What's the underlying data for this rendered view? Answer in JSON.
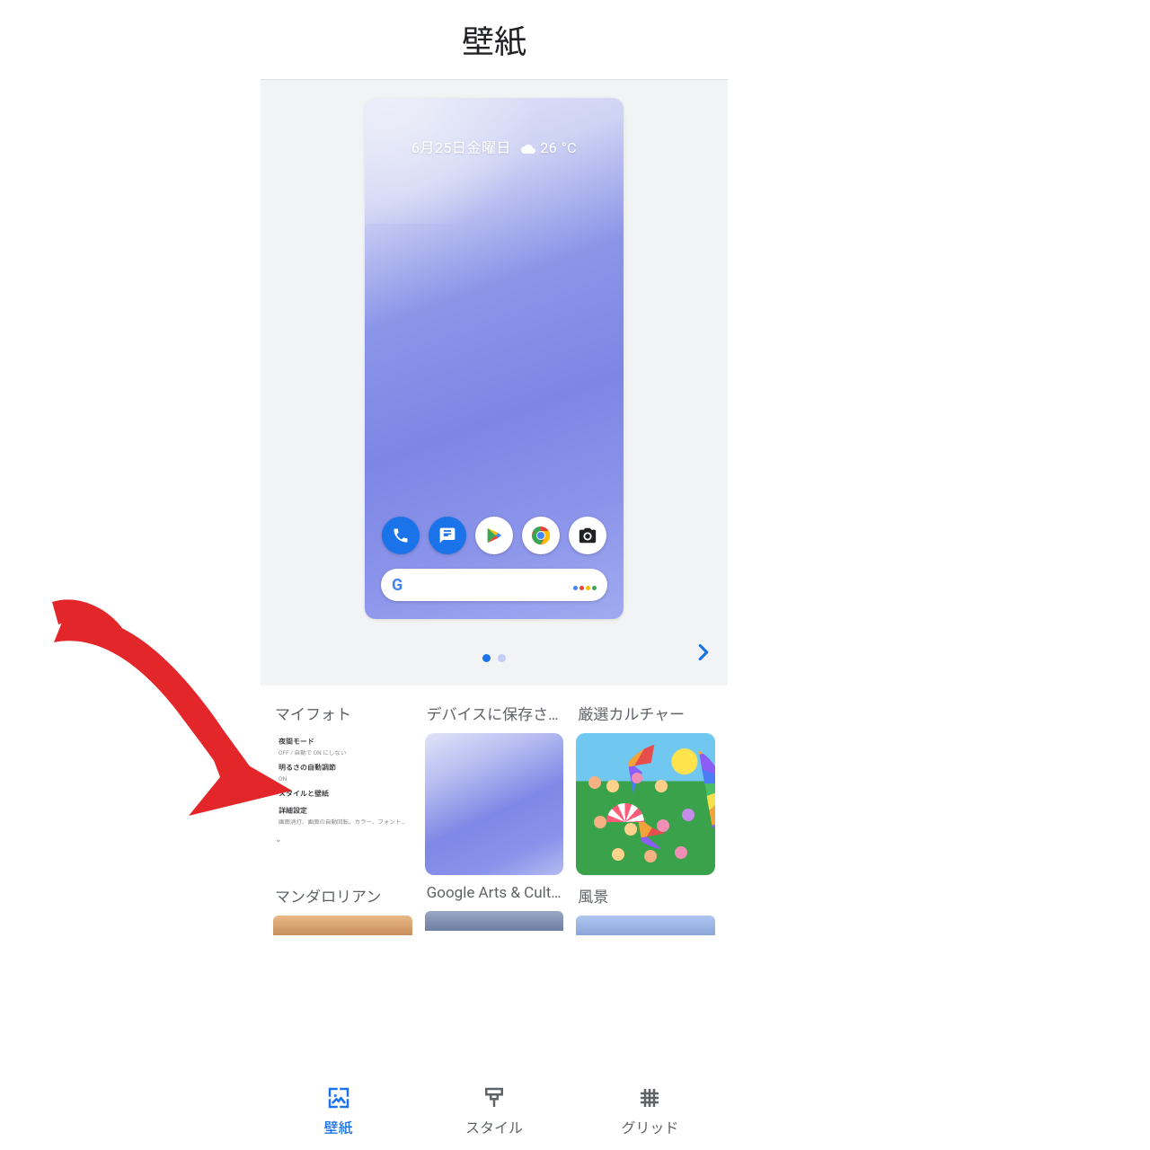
{
  "header": {
    "title": "壁紙"
  },
  "preview": {
    "weather_text": "6月25日金曜日",
    "weather_temp": "26 °C",
    "pager": {
      "active_index": 0,
      "count": 2
    }
  },
  "categories_row1": [
    {
      "title": "マイフォト",
      "settings": [
        {
          "title": "夜間モード",
          "sub": "OFF / 自動で ON にしない"
        },
        {
          "title": "明るさの自動調節",
          "sub": "ON"
        },
        {
          "title": "スタイルと壁紙",
          "sub": ""
        },
        {
          "title": "詳細設定",
          "sub": "画面消灯、画面の自動回転、カラー、フォント…"
        }
      ]
    },
    {
      "title": "デバイスに保存され..."
    },
    {
      "title": "厳選カルチャー"
    }
  ],
  "categories_row2": [
    {
      "title": "マンダロリアン"
    },
    {
      "title": "Google Arts & Cult..."
    },
    {
      "title": "風景"
    }
  ],
  "bottom_nav": [
    {
      "label": "壁紙",
      "active": true
    },
    {
      "label": "スタイル",
      "active": false
    },
    {
      "label": "グリッド",
      "active": false
    }
  ]
}
